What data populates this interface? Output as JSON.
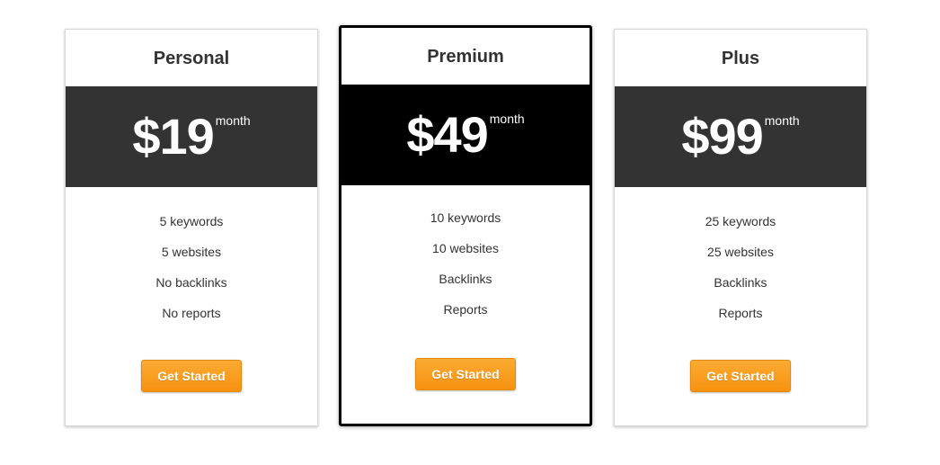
{
  "plans": [
    {
      "name": "Personal",
      "price": "$19",
      "period": "month",
      "features": [
        "5 keywords",
        "5 websites",
        "No backlinks",
        "No reports"
      ],
      "cta": "Get Started"
    },
    {
      "name": "Premium",
      "price": "$49",
      "period": "month",
      "features": [
        "10 keywords",
        "10 websites",
        "Backlinks",
        "Reports"
      ],
      "cta": "Get Started"
    },
    {
      "name": "Plus",
      "price": "$99",
      "period": "month",
      "features": [
        "25 keywords",
        "25 websites",
        "Backlinks",
        "Reports"
      ],
      "cta": "Get Started"
    }
  ],
  "colors": {
    "band_default": "#333333",
    "band_featured": "#000000",
    "button": "#f7920f",
    "text": "#333333"
  }
}
